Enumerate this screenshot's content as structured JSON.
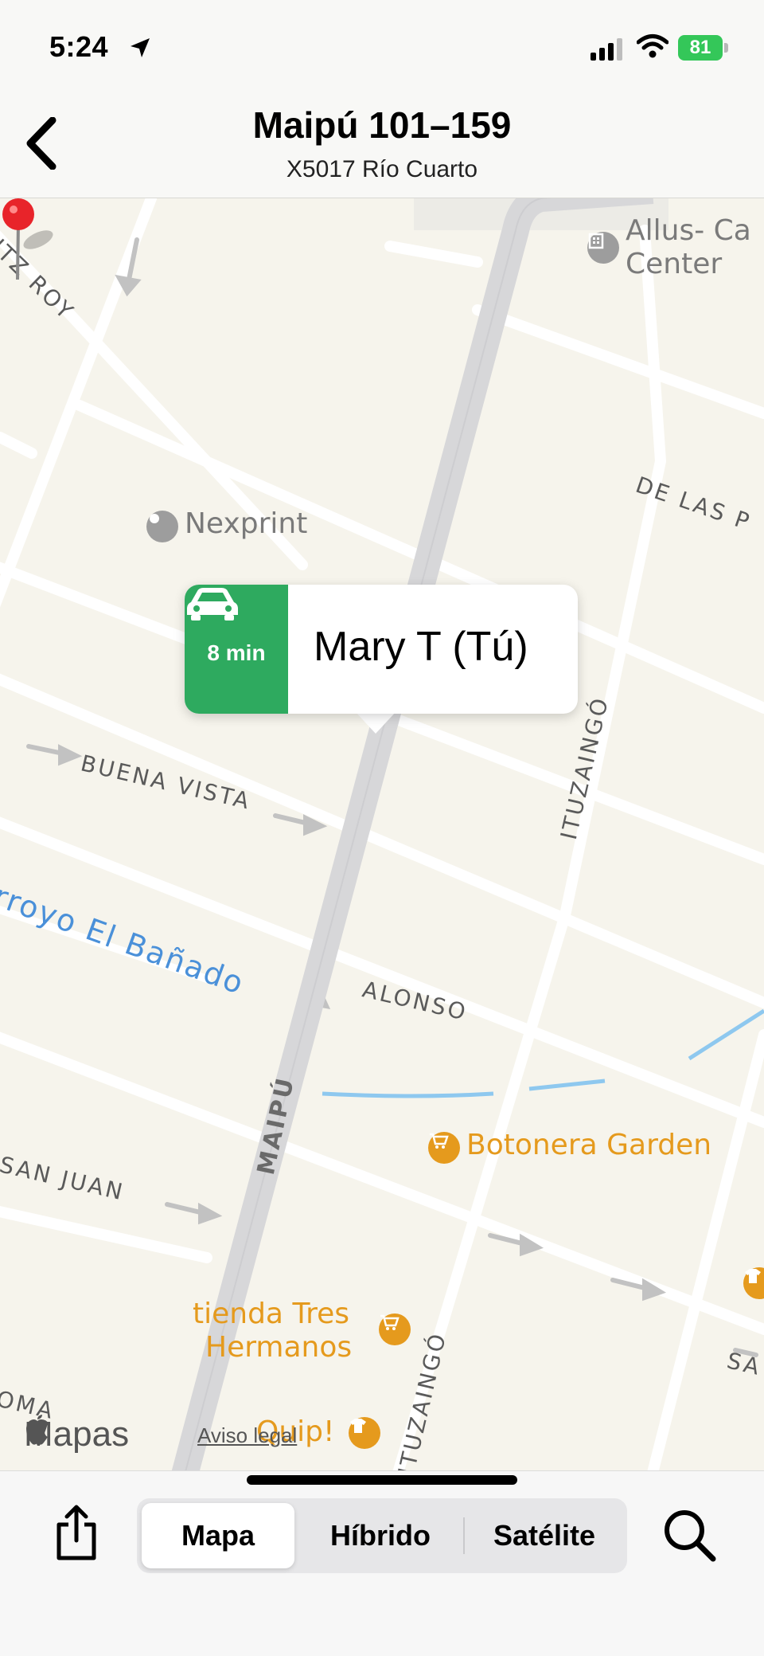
{
  "status_bar": {
    "time": "5:24",
    "battery": "81"
  },
  "header": {
    "title": "Maipú 101–159",
    "subtitle": "X5017 Río Cuarto"
  },
  "map": {
    "streets": {
      "fitz_roy": "ITZ ROY",
      "de_las": "DE LAS P",
      "buena_vista": "BUENA VISTA",
      "ituzaingo_upper": "ITUZAINGÓ",
      "alonso": "ALONSO",
      "maipu": "MAIPÚ",
      "san_juan": "SAN JUAN",
      "ituzaingo_lower": "ITUZAINGÓ",
      "oma": "OMA",
      "sa": "SA"
    },
    "water": "rroyo El Bañado",
    "pois": {
      "allus_line1": "Allus- Ca",
      "allus_line2": "Center",
      "nexprint": "Nexprint",
      "botonera": "Botonera Garden",
      "tienda_line1": "tienda Tres",
      "tienda_line2": "Hermanos",
      "quip": "Quip!"
    },
    "callout": {
      "eta": "8 min",
      "name": "Mary T (Tú)"
    },
    "attribution": {
      "logo": "Mapas",
      "legal": "Aviso legal"
    }
  },
  "toolbar": {
    "segments": [
      "Mapa",
      "Híbrido",
      "Satélite"
    ],
    "selected": "Mapa"
  },
  "colors": {
    "eta_green": "#2eaa5f",
    "poi_orange": "#e59a1d",
    "water_blue": "#4a90d9",
    "battery_green": "#34c759"
  }
}
